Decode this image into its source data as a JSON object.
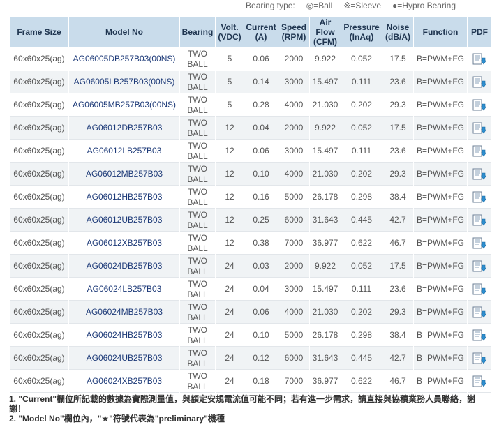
{
  "legend": {
    "title": "Bearing type:",
    "ball": "◎=Ball",
    "sleeve": "※=Sleeve",
    "hypro": "●=Hypro Bearing"
  },
  "columns": [
    "Frame Size",
    "Model No",
    "Bearing",
    "Volt.\n(VDC)",
    "Current\n(A)",
    "Speed\n(RPM)",
    "Air\nFlow\n(CFM)",
    "Pressure\n(InAq)",
    "Noise\n(dB/A)",
    "Function",
    "PDF"
  ],
  "rows": [
    {
      "frame": "60x60x25(ag)",
      "model": "AG06005DB257B03(00NS)",
      "bearing": "TWO\nBALL",
      "volt": "5",
      "current": "0.06",
      "speed": "2000",
      "airflow": "9.922",
      "pressure": "0.052",
      "noise": "17.5",
      "function": "B=PWM+FG"
    },
    {
      "frame": "60x60x25(ag)",
      "model": "AG06005LB257B03(00NS)",
      "bearing": "TWO\nBALL",
      "volt": "5",
      "current": "0.14",
      "speed": "3000",
      "airflow": "15.497",
      "pressure": "0.111",
      "noise": "23.6",
      "function": "B=PWM+FG"
    },
    {
      "frame": "60x60x25(ag)",
      "model": "AG06005MB257B03(00NS)",
      "bearing": "TWO\nBALL",
      "volt": "5",
      "current": "0.28",
      "speed": "4000",
      "airflow": "21.030",
      "pressure": "0.202",
      "noise": "29.3",
      "function": "B=PWM+FG"
    },
    {
      "frame": "60x60x25(ag)",
      "model": "AG06012DB257B03",
      "bearing": "TWO\nBALL",
      "volt": "12",
      "current": "0.04",
      "speed": "2000",
      "airflow": "9.922",
      "pressure": "0.052",
      "noise": "17.5",
      "function": "B=PWM+FG"
    },
    {
      "frame": "60x60x25(ag)",
      "model": "AG06012LB257B03",
      "bearing": "TWO\nBALL",
      "volt": "12",
      "current": "0.06",
      "speed": "3000",
      "airflow": "15.497",
      "pressure": "0.111",
      "noise": "23.6",
      "function": "B=PWM+FG"
    },
    {
      "frame": "60x60x25(ag)",
      "model": "AG06012MB257B03",
      "bearing": "TWO\nBALL",
      "volt": "12",
      "current": "0.10",
      "speed": "4000",
      "airflow": "21.030",
      "pressure": "0.202",
      "noise": "29.3",
      "function": "B=PWM+FG"
    },
    {
      "frame": "60x60x25(ag)",
      "model": "AG06012HB257B03",
      "bearing": "TWO\nBALL",
      "volt": "12",
      "current": "0.16",
      "speed": "5000",
      "airflow": "26.178",
      "pressure": "0.298",
      "noise": "38.4",
      "function": "B=PWM+FG"
    },
    {
      "frame": "60x60x25(ag)",
      "model": "AG06012UB257B03",
      "bearing": "TWO\nBALL",
      "volt": "12",
      "current": "0.25",
      "speed": "6000",
      "airflow": "31.643",
      "pressure": "0.445",
      "noise": "42.7",
      "function": "B=PWM+FG"
    },
    {
      "frame": "60x60x25(ag)",
      "model": "AG06012XB257B03",
      "bearing": "TWO\nBALL",
      "volt": "12",
      "current": "0.38",
      "speed": "7000",
      "airflow": "36.977",
      "pressure": "0.622",
      "noise": "46.7",
      "function": "B=PWM+FG"
    },
    {
      "frame": "60x60x25(ag)",
      "model": "AG06024DB257B03",
      "bearing": "TWO\nBALL",
      "volt": "24",
      "current": "0.03",
      "speed": "2000",
      "airflow": "9.922",
      "pressure": "0.052",
      "noise": "17.5",
      "function": "B=PWM+FG"
    },
    {
      "frame": "60x60x25(ag)",
      "model": "AG06024LB257B03",
      "bearing": "TWO\nBALL",
      "volt": "24",
      "current": "0.04",
      "speed": "3000",
      "airflow": "15.497",
      "pressure": "0.111",
      "noise": "23.6",
      "function": "B=PWM+FG"
    },
    {
      "frame": "60x60x25(ag)",
      "model": "AG06024MB257B03",
      "bearing": "TWO\nBALL",
      "volt": "24",
      "current": "0.06",
      "speed": "4000",
      "airflow": "21.030",
      "pressure": "0.202",
      "noise": "29.3",
      "function": "B=PWM+FG"
    },
    {
      "frame": "60x60x25(ag)",
      "model": "AG06024HB257B03",
      "bearing": "TWO\nBALL",
      "volt": "24",
      "current": "0.10",
      "speed": "5000",
      "airflow": "26.178",
      "pressure": "0.298",
      "noise": "38.4",
      "function": "B=PWM+FG"
    },
    {
      "frame": "60x60x25(ag)",
      "model": "AG06024UB257B03",
      "bearing": "TWO\nBALL",
      "volt": "24",
      "current": "0.12",
      "speed": "6000",
      "airflow": "31.643",
      "pressure": "0.445",
      "noise": "42.7",
      "function": "B=PWM+FG"
    },
    {
      "frame": "60x60x25(ag)",
      "model": "AG06024XB257B03",
      "bearing": "TWO\nBALL",
      "volt": "24",
      "current": "0.18",
      "speed": "7000",
      "airflow": "36.977",
      "pressure": "0.622",
      "noise": "46.7",
      "function": "B=PWM+FG"
    }
  ],
  "pdf_icon": "pdf-download-icon",
  "colors": {
    "header_bg": "#c9dceb",
    "header_text": "#1f3550",
    "model_link": "#1d3a78",
    "alt_row": "#f0f3f5"
  },
  "notes": [
    "1. \"Current\"欄位所記載的數據為實際測量值，與額定安規電流值可能不同；若有進一步需求，請直接與協積業務人員聯絡，謝謝！",
    "2. \"Model No\"欄位內，\"★\"符號代表為\"preliminary\"機種"
  ]
}
